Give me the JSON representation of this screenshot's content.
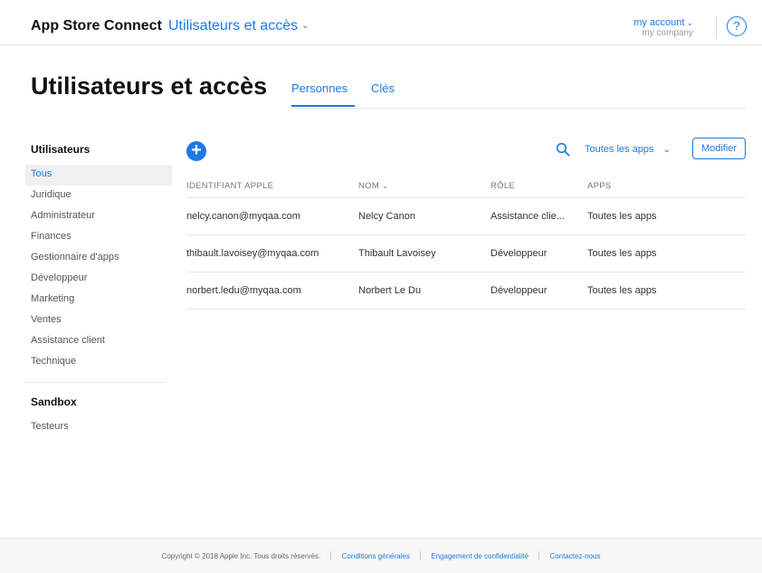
{
  "topbar": {
    "brand": "App Store Connect",
    "section": "Utilisateurs et accès",
    "account_name": "my account",
    "account_company": "my company",
    "help_label": "?"
  },
  "page": {
    "title": "Utilisateurs et accès",
    "tabs": [
      {
        "label": "Personnes",
        "active": true
      },
      {
        "label": "Clés",
        "active": false
      }
    ]
  },
  "sidebar": {
    "users_heading": "Utilisateurs",
    "users_items": [
      {
        "label": "Tous",
        "selected": true
      },
      {
        "label": "Juridique"
      },
      {
        "label": "Administrateur"
      },
      {
        "label": "Finances"
      },
      {
        "label": "Gestionnaire d'apps"
      },
      {
        "label": "Développeur"
      },
      {
        "label": "Marketing"
      },
      {
        "label": "Ventes"
      },
      {
        "label": "Assistance client"
      },
      {
        "label": "Technique"
      }
    ],
    "sandbox_heading": "Sandbox",
    "sandbox_items": [
      {
        "label": "Testeurs"
      }
    ]
  },
  "toolbar": {
    "add_label": "+",
    "filter_label": "Toutes les apps",
    "edit_label": "Modifier"
  },
  "table": {
    "headers": [
      "IDENTIFIANT APPLE",
      "NOM",
      "RÔLE",
      "APPS"
    ],
    "rows": [
      [
        "nelcy.canon@myqaa.com",
        "Nelcy Canon",
        "Assistance clie...",
        "Toutes les apps"
      ],
      [
        "thibault.lavoisey@myqaa.com",
        "Thibault Lavoisey",
        "Développeur",
        "Toutes les apps"
      ],
      [
        "norbert.ledu@myqaa.com",
        "Norbert Le Du",
        "Développeur",
        "Toutes les apps"
      ]
    ]
  },
  "footer": {
    "copyright": "Copyright © 2018 Apple Inc. Tous droits réservés.",
    "links": [
      "Conditions générales",
      "Engagement de confidentialité",
      "Contactez-nous"
    ]
  },
  "colors": {
    "accent": "#1b7ae8"
  }
}
